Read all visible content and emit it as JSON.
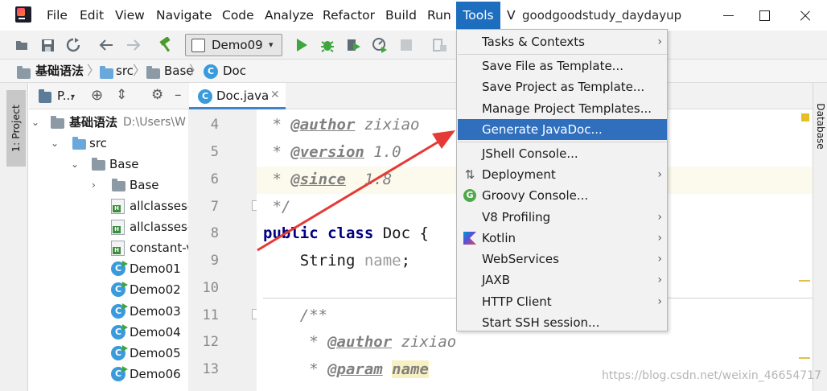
{
  "menubar": {
    "items": [
      "File",
      "Edit",
      "View",
      "Navigate",
      "Code",
      "Analyze",
      "Refactor",
      "Build",
      "Run"
    ],
    "active": "Tools",
    "overflow": "V",
    "window_title": "goodgoodstudy_daydayup"
  },
  "toolbar": {
    "run_config": "Demo09",
    "icons": [
      "open-icon",
      "save-icon",
      "sync-icon",
      "back-icon",
      "forward-icon",
      "build-hammer-icon",
      "run-icon",
      "debug-icon",
      "coverage-icon",
      "profile-icon",
      "stop-icon",
      "vcs-icon"
    ]
  },
  "breadcrumb": {
    "items": [
      "基础语法",
      "src",
      "Base",
      "Doc"
    ]
  },
  "left_stripe": {
    "project_tab": "1: Project"
  },
  "project_panel": {
    "title": "P...",
    "root": {
      "label": "基础语法",
      "path": "D:\\Users\\W"
    },
    "tree": [
      "src",
      "Base",
      "Base",
      "allclasses-",
      "allclasses-",
      "constant-v",
      "Demo01",
      "Demo02",
      "Demo03",
      "Demo04",
      "Demo05",
      "Demo06"
    ]
  },
  "editor": {
    "tab": "Doc.java",
    "line_numbers": [
      "4",
      "5",
      "6",
      "7",
      "8",
      "9",
      "10",
      "11",
      "12",
      "13"
    ],
    "lines": [
      {
        "t1": " * ",
        "tag": "@author",
        "rest": " zixiao"
      },
      {
        "t1": " * ",
        "tag": "@version",
        "rest": " 1.0"
      },
      {
        "t1": " * ",
        "tag": "@since",
        "rest": "  1.8"
      },
      {
        "t1": " */"
      },
      {
        "kw": "public class",
        "rest": " Doc {"
      },
      {
        "type": "    String ",
        "field": "name",
        "rest": ";"
      },
      {
        "t1": ""
      },
      {
        "t1": "    /**"
      },
      {
        "t1": "     * ",
        "tag": "@author",
        "rest": " zixiao"
      },
      {
        "t1": "     * ",
        "tag": "@param",
        "param": "name"
      }
    ]
  },
  "right_stripe": {
    "database_tab": "Database"
  },
  "tools_menu": {
    "items": [
      {
        "label": "Tasks & Contexts",
        "submenu": true
      },
      {
        "label": "Save File as Template..."
      },
      {
        "label": "Save Project as Template..."
      },
      {
        "label": "Manage Project Templates..."
      },
      {
        "label": "Generate JavaDoc...",
        "selected": true
      },
      {
        "label": "JShell Console..."
      },
      {
        "label": "Deployment",
        "submenu": true,
        "icon": "deployment-icon"
      },
      {
        "label": "Groovy Console...",
        "icon": "groovy-icon"
      },
      {
        "label": "V8 Profiling",
        "submenu": true
      },
      {
        "label": "Kotlin",
        "submenu": true,
        "icon": "kotlin-icon"
      },
      {
        "label": "WebServices",
        "submenu": true
      },
      {
        "label": "JAXB",
        "submenu": true
      },
      {
        "label": "HTTP Client",
        "submenu": true
      },
      {
        "label": "Start SSH session..."
      }
    ]
  },
  "annotation": {
    "color": "#e53a35"
  },
  "watermark": "https://blog.csdn.net/weixin_46654717"
}
